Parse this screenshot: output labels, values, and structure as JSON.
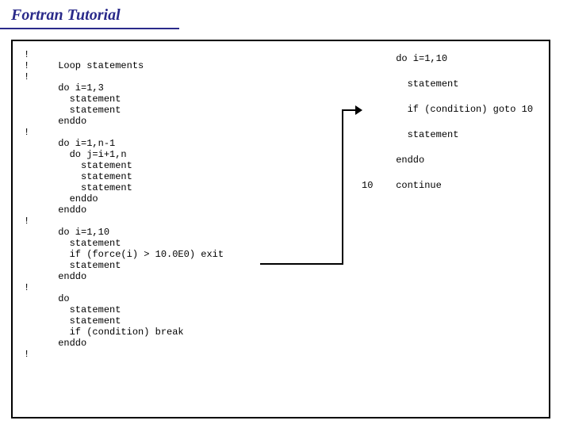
{
  "title": "Fortran Tutorial",
  "code_left": "!\n!     Loop statements\n!\n      do i=1,3\n        statement\n        statement\n      enddo\n!\n      do i=1,n-1\n        do j=i+1,n\n          statement\n          statement\n          statement\n        enddo\n      enddo\n!\n      do i=1,10\n        statement\n        if (force(i) > 10.0E0) exit\n        statement\n      enddo\n!\n      do\n        statement\n        statement\n        if (condition) break\n      enddo\n!",
  "code_right": "      do i=1,10\n\n        statement\n\n        if (condition) goto 10\n\n        statement\n\n      enddo\n\n10    continue"
}
